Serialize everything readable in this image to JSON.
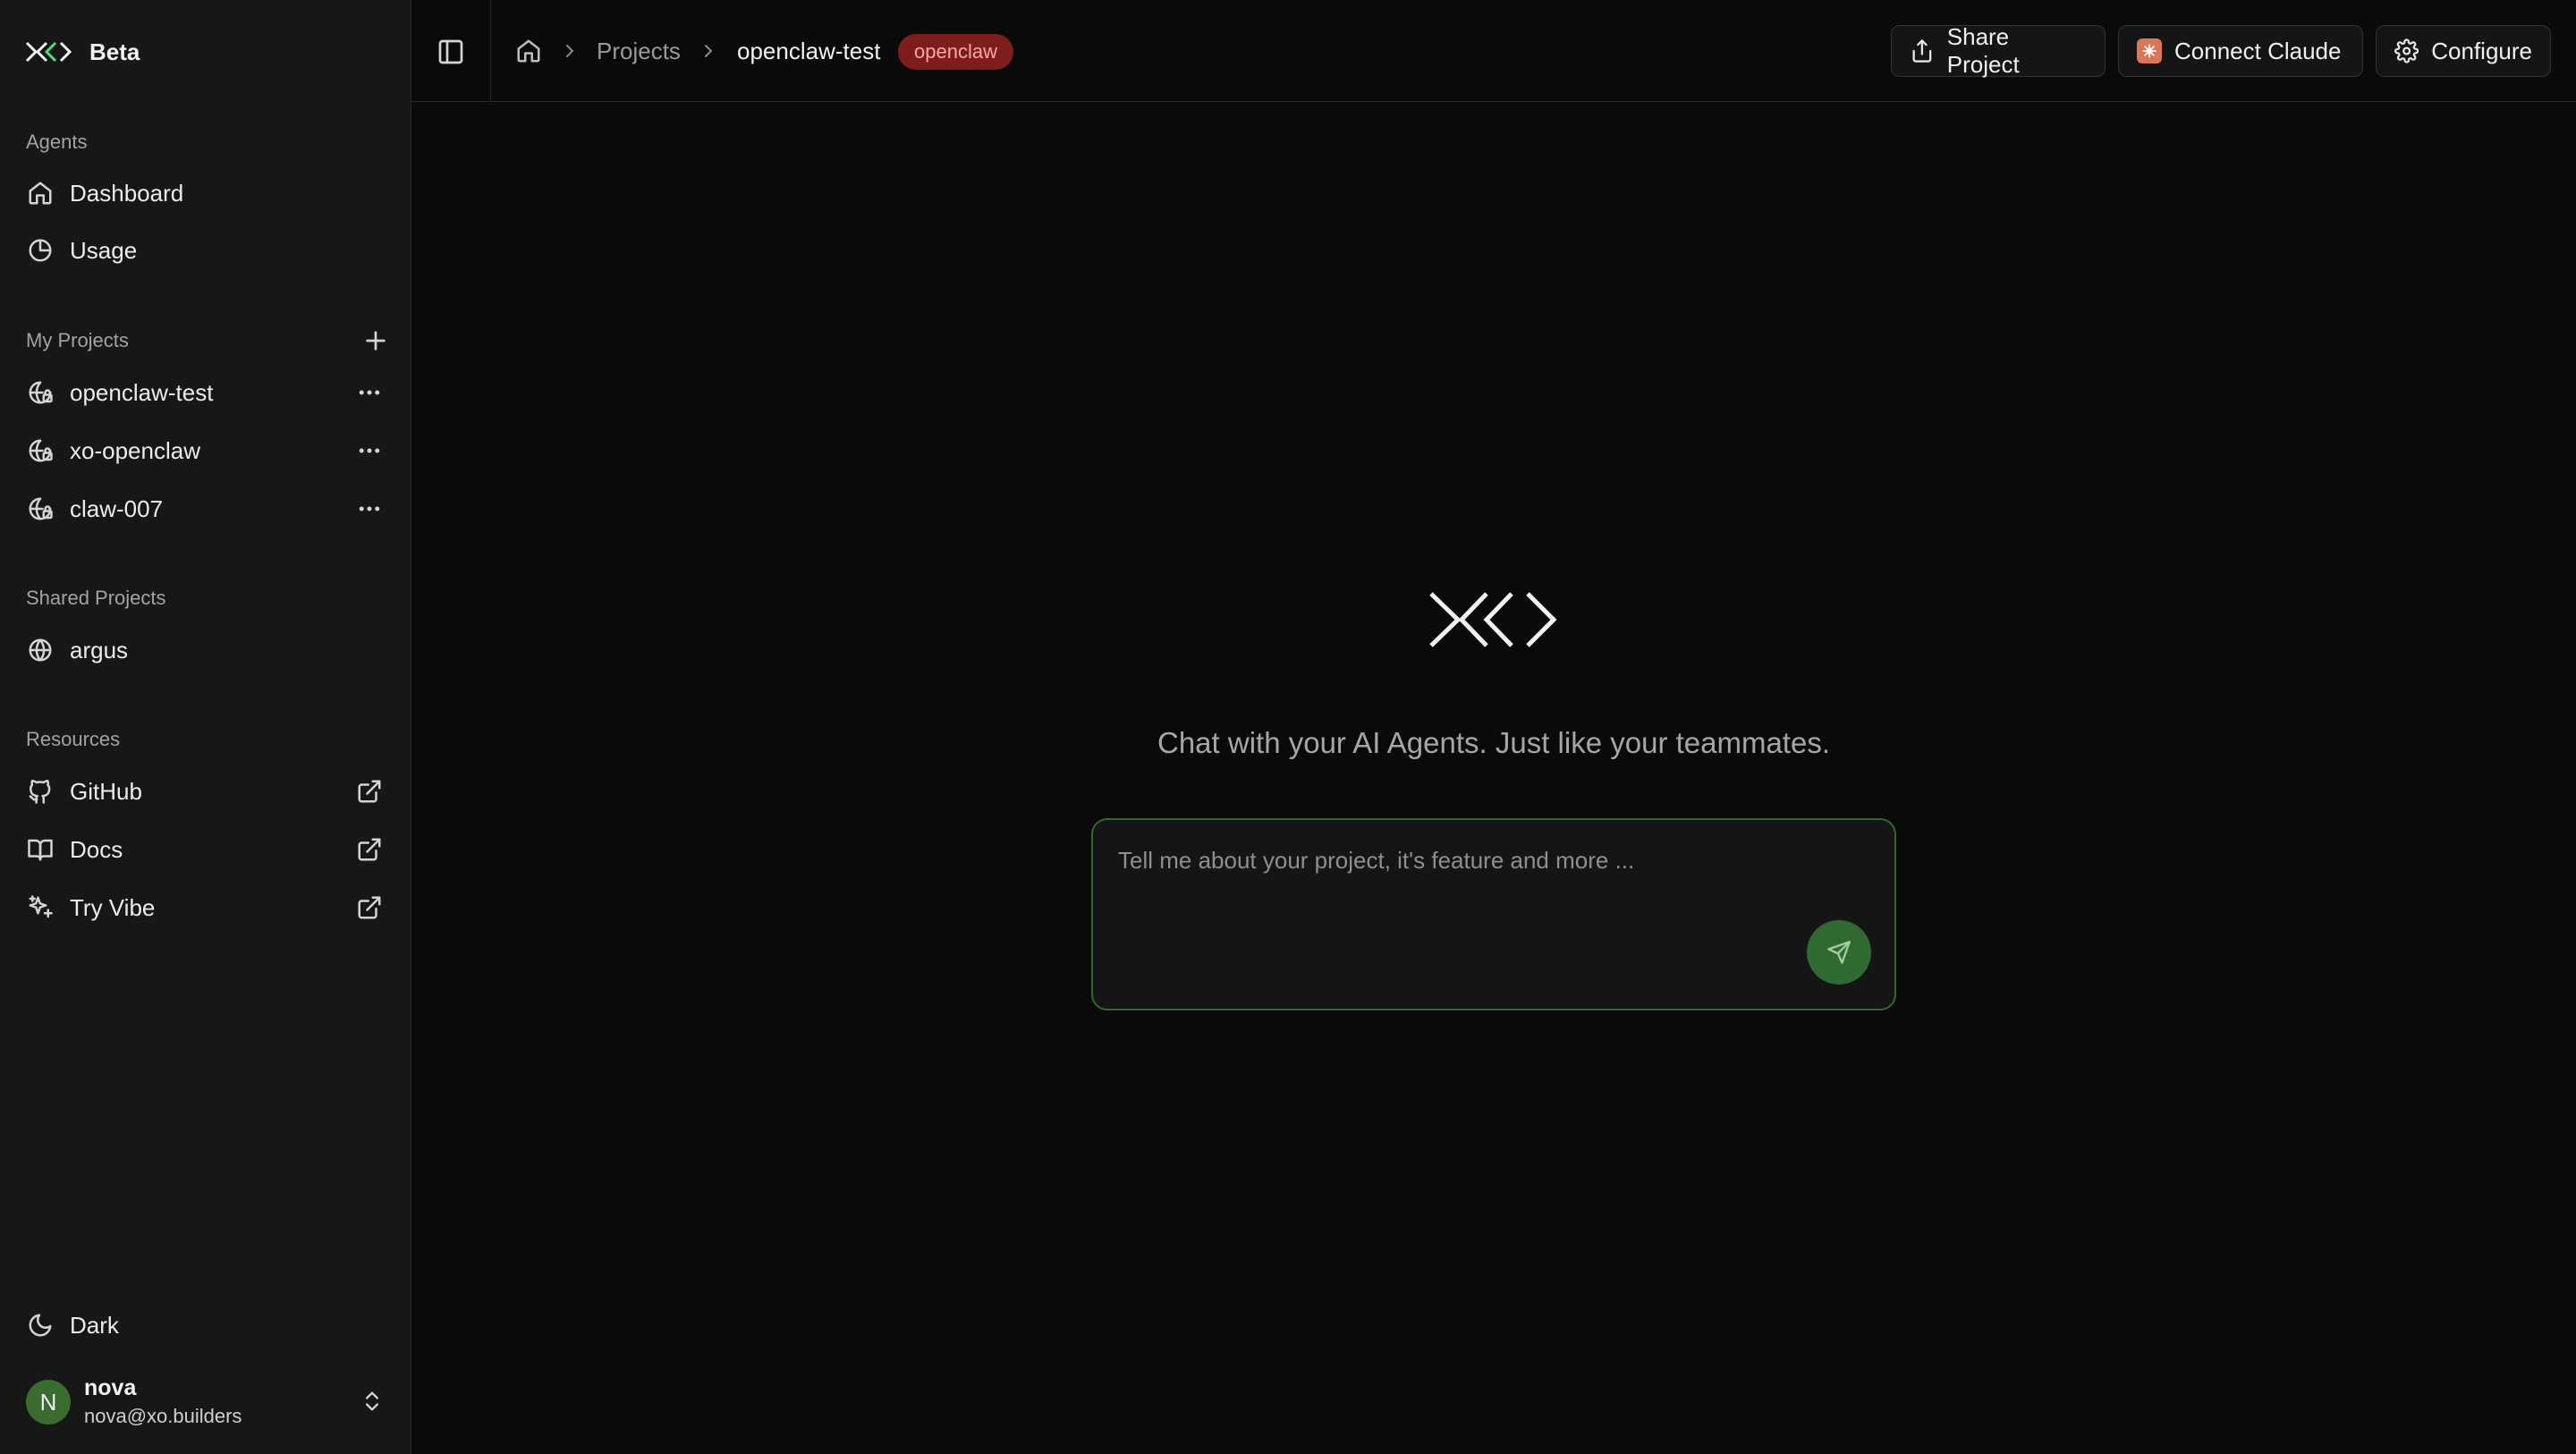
{
  "brand": {
    "name": "Beta"
  },
  "sidebar": {
    "agents_label": "Agents",
    "agents": [
      {
        "label": "Dashboard",
        "icon": "home-icon"
      },
      {
        "label": "Usage",
        "icon": "pie-chart-icon"
      }
    ],
    "my_projects_label": "My Projects",
    "my_projects": [
      {
        "label": "openclaw-test",
        "icon": "globe-lock-icon"
      },
      {
        "label": "xo-openclaw",
        "icon": "globe-lock-icon"
      },
      {
        "label": "claw-007",
        "icon": "globe-lock-icon"
      }
    ],
    "shared_projects_label": "Shared Projects",
    "shared_projects": [
      {
        "label": "argus",
        "icon": "globe-icon"
      }
    ],
    "resources_label": "Resources",
    "resources": [
      {
        "label": "GitHub",
        "icon": "github-icon"
      },
      {
        "label": "Docs",
        "icon": "book-icon"
      },
      {
        "label": "Try Vibe",
        "icon": "sparkles-icon"
      }
    ],
    "theme_label": "Dark",
    "user": {
      "initial": "N",
      "name": "nova",
      "email": "nova@xo.builders"
    }
  },
  "topbar": {
    "breadcrumbs": [
      "Projects",
      "openclaw-test"
    ],
    "badge": "openclaw",
    "buttons": {
      "share": "Share Project",
      "connect": "Connect Claude",
      "configure": "Configure"
    }
  },
  "main": {
    "tagline": "Chat with your AI Agents. Just like your teammates.",
    "composer_placeholder": "Tell me about your project, it's feature and more ..."
  },
  "colors": {
    "background": "#0a0a0a",
    "sidebar": "#171717",
    "accent_green": "#2f6a31",
    "badge_bg": "#7f1d1d",
    "badge_text": "#fca5a5",
    "claude_orange": "#d97757"
  }
}
